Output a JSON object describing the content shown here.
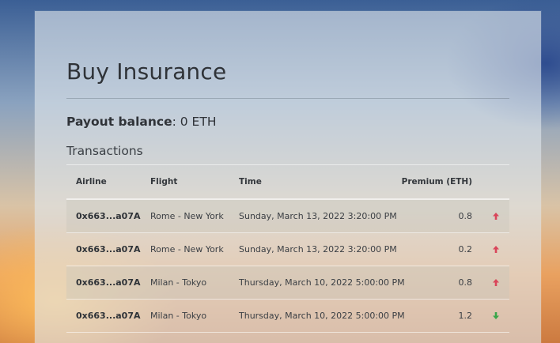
{
  "page": {
    "title": "Buy Insurance"
  },
  "balance": {
    "label": "Payout balance",
    "separator": ":",
    "value": "0 ETH"
  },
  "transactions": {
    "heading": "Transactions",
    "columns": [
      "Airline",
      "Flight",
      "Time",
      "Premium (ETH)"
    ],
    "rows": [
      {
        "airline": "0x663...a07A",
        "flight": "Rome - New York",
        "time": "Sunday, March 13, 2022 3:20:00 PM",
        "premium": "0.8",
        "direction": "up"
      },
      {
        "airline": "0x663...a07A",
        "flight": "Rome - New York",
        "time": "Sunday, March 13, 2022 3:20:00 PM",
        "premium": "0.2",
        "direction": "up"
      },
      {
        "airline": "0x663...a07A",
        "flight": "Milan - Tokyo",
        "time": "Thursday, March 10, 2022 5:00:00 PM",
        "premium": "0.8",
        "direction": "up"
      },
      {
        "airline": "0x663...a07A",
        "flight": "Milan - Tokyo",
        "time": "Thursday, March 10, 2022 5:00:00 PM",
        "premium": "1.2",
        "direction": "down"
      }
    ]
  },
  "colors": {
    "up": "#d9455a",
    "down": "#3aa64a"
  },
  "icons": {
    "up": "arrow-up-icon",
    "down": "arrow-down-icon"
  }
}
